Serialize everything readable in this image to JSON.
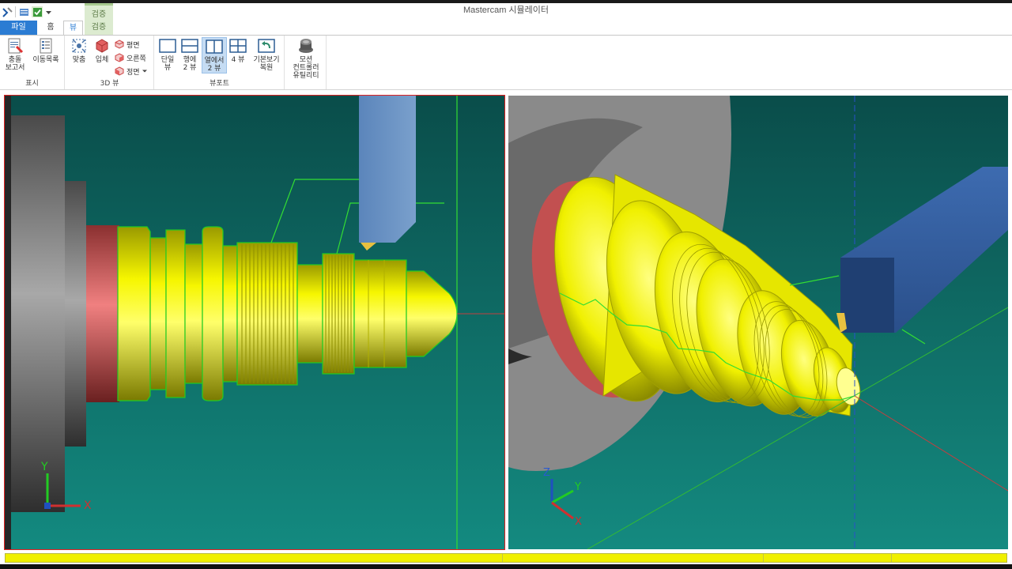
{
  "window": {
    "title": "Mastercam 시뮬레이터"
  },
  "context_tab_group": "검증",
  "tabs": [
    {
      "label": "파일"
    },
    {
      "label": "홈"
    },
    {
      "label": "뷰"
    },
    {
      "label": "검증"
    }
  ],
  "ribbon": {
    "display": {
      "label": "표시",
      "collision_report": "충돌\n보고서",
      "move_list": "이동목록"
    },
    "view3d": {
      "label": "3D 뷰",
      "fit": "맞춤",
      "solid": "입체",
      "top": "평면",
      "right": "오른쪽",
      "front": "정면"
    },
    "viewport": {
      "label": "뷰포트",
      "single": "단일\n뷰",
      "row2": "행에\n2 뷰",
      "col2": "열에서\n2 뷰",
      "four": "4 뷰",
      "reset": "기본보기\n복원"
    },
    "utility": {
      "motion_controller": "모션\n컨트롤러\n유틸리티"
    }
  },
  "left_viewport": {
    "axis_x": "X",
    "axis_y": "Y"
  },
  "right_viewport": {
    "axis_x": "X",
    "axis_y": "Y",
    "axis_z": "Z"
  },
  "simulation": {
    "progress": 1.0
  },
  "colors": {
    "background": "#0d5a55",
    "part": "#f2f200",
    "chuck_face": "#e05a5a",
    "tool": "#4a74a8",
    "toolpath": "#22dd22",
    "active_border": "#e02020"
  }
}
